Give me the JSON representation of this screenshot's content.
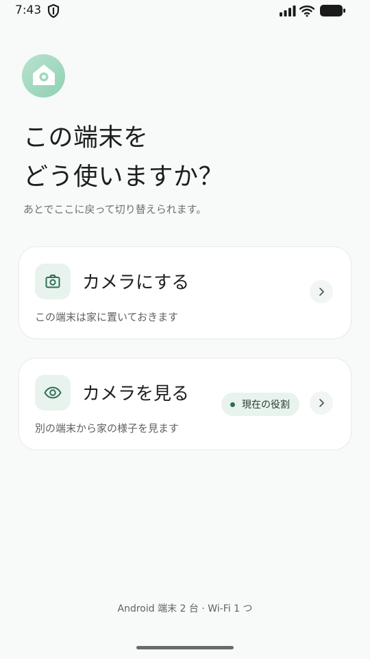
{
  "status_bar": {
    "time": "7:43",
    "icons": [
      "shield-icon",
      "signal-icon",
      "wifi-icon",
      "battery-icon"
    ]
  },
  "header": {
    "logo_icon": "home-icon",
    "title_line1": "この端末を",
    "title_line2": "どう使いますか？",
    "subtitle": "あとでここに戻って切り替えられます。"
  },
  "options": [
    {
      "icon": "camera-icon",
      "title": "カメラにする",
      "description": "この端末は家に置いておきます"
    },
    {
      "icon": "eye-icon",
      "title": "カメラを見る",
      "description": "別の端末から家の様子を見ます",
      "badge": "現在の役割"
    }
  ],
  "footer": {
    "note": "Android 端末 2 台 · Wi-Fi 1 つ"
  },
  "colors": {
    "accent": "#2e6e52",
    "accent_light": "#e8f3ee",
    "logo": "#9fd8bd",
    "background": "#f7faf8"
  }
}
